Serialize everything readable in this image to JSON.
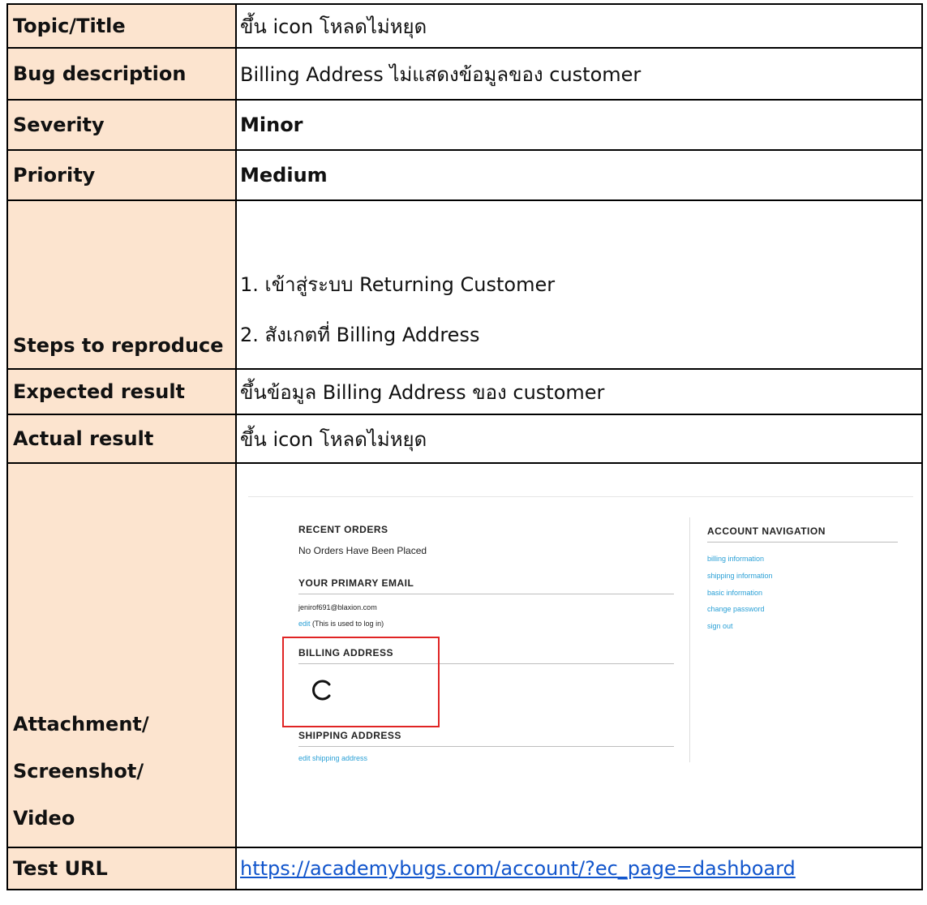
{
  "rows": {
    "topic": {
      "label": "Topic/Title",
      "value": "ขึ้น icon โหลดไม่หยุด"
    },
    "description": {
      "label": "Bug description",
      "value": "Billing Address ไม่แสดงข้อมูลของ customer"
    },
    "severity": {
      "label": "Severity",
      "value": "Minor"
    },
    "priority": {
      "label": "Priority",
      "value": "Medium"
    },
    "steps": {
      "label": "Steps to reproduce",
      "items": [
        "1. เข้าสู่ระบบ Returning Customer",
        "2. สังเกตที่ Billing Address"
      ]
    },
    "expected": {
      "label": "Expected result",
      "value": "ขึ้นข้อมูล Billing Address ของ customer"
    },
    "actual": {
      "label": "Actual result",
      "value": "ขึ้น icon โหลดไม่หยุด"
    },
    "attachment": {
      "label_lines": [
        "Attachment/",
        "Screenshot/",
        "Video"
      ]
    },
    "url": {
      "label": "Test URL",
      "value": "https://academybugs.com/account/?ec_page=dashboard"
    }
  },
  "screenshot": {
    "recent_orders_heading": "RECENT ORDERS",
    "no_orders_text": "No Orders Have Been Placed",
    "primary_email_heading": "YOUR PRIMARY EMAIL",
    "email": "jenirof691@blaxion.com",
    "edit_link": "edit",
    "edit_note": "(This is used to log in)",
    "billing_heading": "BILLING ADDRESS",
    "shipping_heading": "SHIPPING ADDRESS",
    "edit_shipping_link": "edit shipping address",
    "account_nav_heading": "ACCOUNT NAVIGATION",
    "nav_links": [
      "billing information",
      "shipping information",
      "basic information",
      "change password",
      "sign out"
    ],
    "highlight_color": "#e02424",
    "link_color": "#2aa0d6",
    "loading_icon": "spinner-icon"
  },
  "colors": {
    "label_bg": "#fce4cf",
    "url_link": "#1155cc"
  }
}
